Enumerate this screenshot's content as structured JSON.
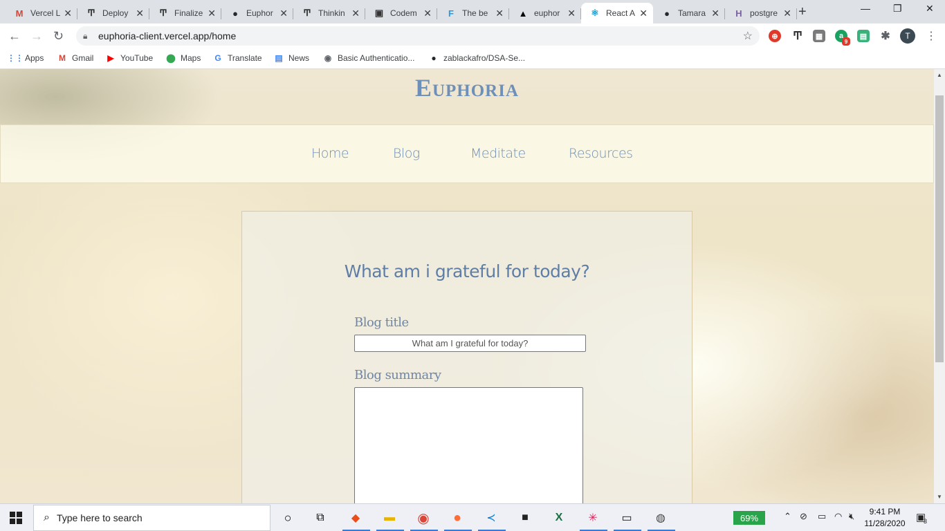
{
  "browser": {
    "tabs": [
      {
        "title": "Vercel L",
        "icon": "gmail-icon",
        "glyph": "M",
        "color": "#d44638",
        "active": false
      },
      {
        "title": "Deploy",
        "icon": "typora-icon",
        "glyph": "Ͳ",
        "color": "#333333",
        "active": false
      },
      {
        "title": "Finalize",
        "icon": "typora-icon",
        "glyph": "Ͳ",
        "color": "#333333",
        "active": false
      },
      {
        "title": "Euphor",
        "icon": "github-icon",
        "glyph": "●",
        "color": "#24292e",
        "active": false
      },
      {
        "title": "Thinkin",
        "icon": "typora-icon",
        "glyph": "Ͳ",
        "color": "#333333",
        "active": false
      },
      {
        "title": "Codem",
        "icon": "codementor-icon",
        "glyph": "▣",
        "color": "#333333",
        "active": false
      },
      {
        "title": "The be",
        "icon": "f-icon",
        "glyph": "F",
        "color": "#1a9cf0",
        "active": false
      },
      {
        "title": "euphor",
        "icon": "vercel-icon",
        "glyph": "▲",
        "color": "#000000",
        "active": false
      },
      {
        "title": "React A",
        "icon": "react-icon",
        "glyph": "⚛",
        "color": "#149eca",
        "active": true
      },
      {
        "title": "Tamara",
        "icon": "github-icon",
        "glyph": "●",
        "color": "#24292e",
        "active": false
      },
      {
        "title": "postgre",
        "icon": "heroku-icon",
        "glyph": "H",
        "color": "#7b5ea7",
        "active": false
      }
    ],
    "url": "euphoria-client.vercel.app/home",
    "profile_initial": "T",
    "ext_badge": "9",
    "bookmarks": [
      {
        "label": "Apps",
        "icon": "apps-grid-icon",
        "glyph": "⋮⋮",
        "color": "#4285f4"
      },
      {
        "label": "Gmail",
        "icon": "gmail-icon",
        "glyph": "M",
        "color": "#d44638"
      },
      {
        "label": "YouTube",
        "icon": "youtube-icon",
        "glyph": "▶",
        "color": "#ff0000"
      },
      {
        "label": "Maps",
        "icon": "maps-pin-icon",
        "glyph": "⬤",
        "color": "#34a853"
      },
      {
        "label": "Translate",
        "icon": "translate-icon",
        "glyph": "G",
        "color": "#4285f4"
      },
      {
        "label": "News",
        "icon": "news-icon",
        "glyph": "▤",
        "color": "#4285f4"
      },
      {
        "label": "Basic Authenticatio...",
        "icon": "globe-icon",
        "glyph": "◉",
        "color": "#5f6368"
      },
      {
        "label": "zablackafro/DSA-Se...",
        "icon": "github-icon",
        "glyph": "●",
        "color": "#24292e"
      }
    ]
  },
  "site": {
    "brand": "Euphoria",
    "nav": [
      "Home",
      "Blog",
      "Meditate",
      "Resources"
    ],
    "form": {
      "heading": "What am i grateful for today?",
      "title_label": "Blog title",
      "title_value": "What am I grateful for today?",
      "summary_label": "Blog summary",
      "summary_value": ""
    }
  },
  "taskbar": {
    "search_placeholder": "Type here to search",
    "battery": "69%",
    "time": "9:41 PM",
    "date": "11/28/2020",
    "notification_count": "3"
  }
}
